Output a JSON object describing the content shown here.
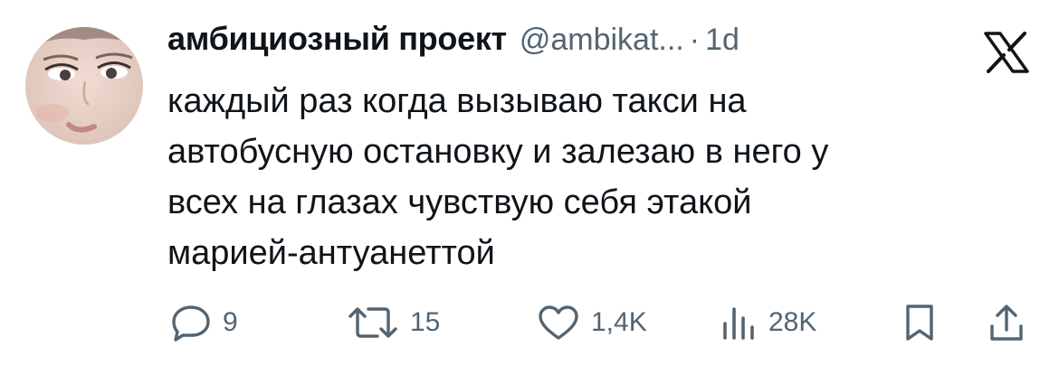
{
  "author": {
    "display_name": "амбициозный проект",
    "handle": "@ambikat...",
    "separator": "·",
    "time": "1d"
  },
  "tweet": {
    "lines": [
      "каждый раз когда вызываю такси на",
      "автобусную остановку и залезаю в него у",
      "всех на глазах чувствую себя этакой",
      "марией-антуанеттой"
    ]
  },
  "metrics": {
    "replies": "9",
    "reposts": "15",
    "likes": "1,4K",
    "views": "28K"
  },
  "icons": {
    "brand": "x-logo-icon",
    "reply": "reply-icon",
    "repost": "repost-icon",
    "like": "heart-icon",
    "views": "views-icon",
    "bookmark": "bookmark-icon",
    "share": "share-icon"
  },
  "colors": {
    "text": "#0f1419",
    "secondary": "#536471",
    "background": "#ffffff"
  }
}
